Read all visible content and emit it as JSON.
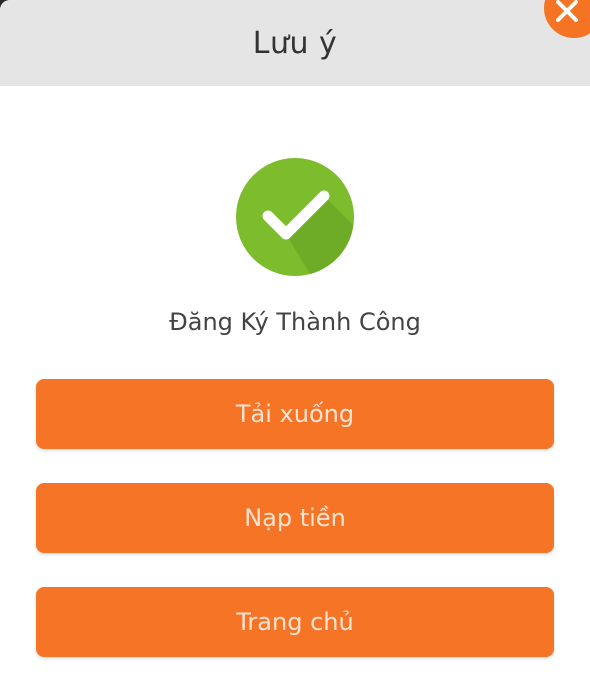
{
  "dialog": {
    "title": "Lưu ý",
    "status_message": "Đăng Ký Thành Công",
    "buttons": {
      "download": "Tải xuống",
      "top_up": "Nạp tiền",
      "home": "Trang chủ"
    }
  },
  "icons": {
    "success": "check-circle-icon",
    "close": "close-icon"
  },
  "colors": {
    "accent": "#f67426",
    "success": "#7cbc2d",
    "header_bg": "#e5e5e5"
  }
}
